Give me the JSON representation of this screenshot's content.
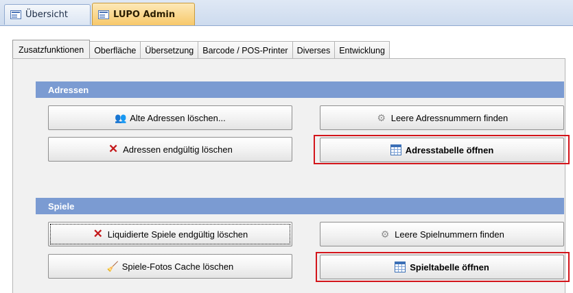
{
  "doc_tabs": [
    {
      "label": "Übersicht",
      "icon": "form-icon"
    },
    {
      "label": "LUPO Admin",
      "icon": "form-icon"
    }
  ],
  "tabs": [
    "Zusatzfunktionen",
    "Oberfläche",
    "Übersetzung",
    "Barcode / POS-Printer",
    "Diverses",
    "Entwicklung"
  ],
  "sections": {
    "adressen": {
      "title": "Adressen",
      "buttons": {
        "alte": {
          "label": "Alte Adressen löschen...",
          "icon": "users-icon"
        },
        "leere": {
          "label": "Leere Adressnummern finden",
          "icon": "gear-icon"
        },
        "endgueltig": {
          "label": "Adressen endgültig löschen",
          "icon": "delete-x-icon"
        },
        "tabelle": {
          "label": "Adresstabelle öffnen",
          "icon": "table-icon"
        }
      }
    },
    "spiele": {
      "title": "Spiele",
      "buttons": {
        "liquidiert": {
          "label": "Liquidierte Spiele endgültig löschen",
          "icon": "delete-x-icon"
        },
        "leere": {
          "label": "Leere Spielnummern finden",
          "icon": "gear-icon"
        },
        "cache": {
          "label": "Spiele-Fotos Cache löschen",
          "icon": "broom-icon"
        },
        "tabelle": {
          "label": "Spieltabelle öffnen",
          "icon": "table-icon"
        }
      }
    }
  },
  "colors": {
    "section_header": "#7b9bd2",
    "highlight": "#d3141a",
    "active_doc_tab": "#f7c86a"
  }
}
